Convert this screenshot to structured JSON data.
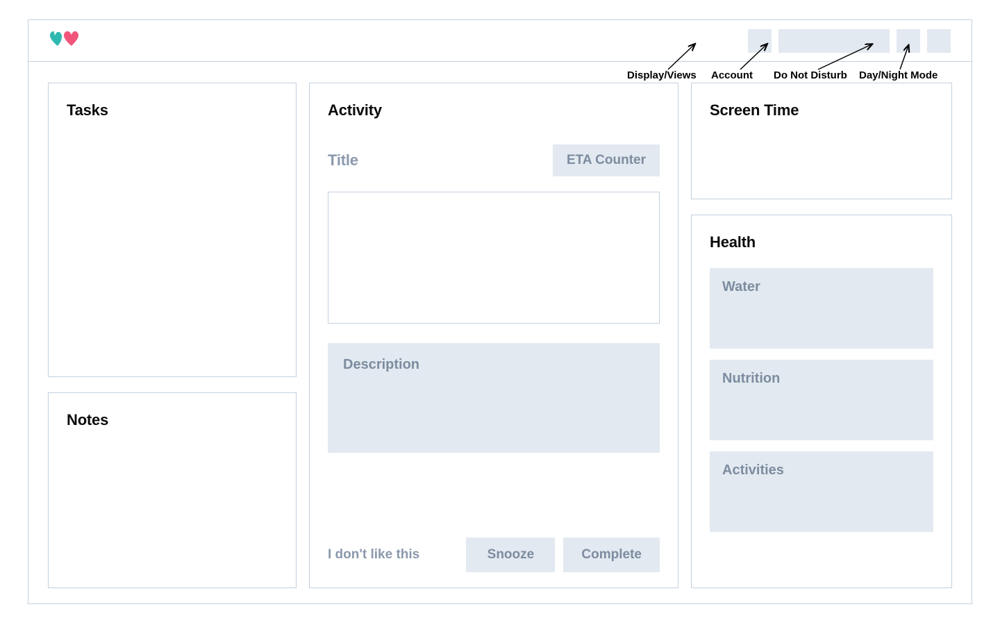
{
  "header": {
    "annotations": {
      "display_views": "Display/Views",
      "account": "Account",
      "do_not_disturb": "Do Not Disturb",
      "day_night_mode": "Day/Night Mode"
    }
  },
  "left": {
    "tasks_title": "Tasks",
    "notes_title": "Notes"
  },
  "activity": {
    "title": "Activity",
    "title_label": "Title",
    "eta_counter": "ETA Counter",
    "description_label": "Description",
    "dislike_text": "I don't like this",
    "snooze_label": "Snooze",
    "complete_label": "Complete"
  },
  "right": {
    "screen_time_title": "Screen Time",
    "health_title": "Health",
    "water_label": "Water",
    "nutrition_label": "Nutrition",
    "activities_label": "Activities"
  }
}
